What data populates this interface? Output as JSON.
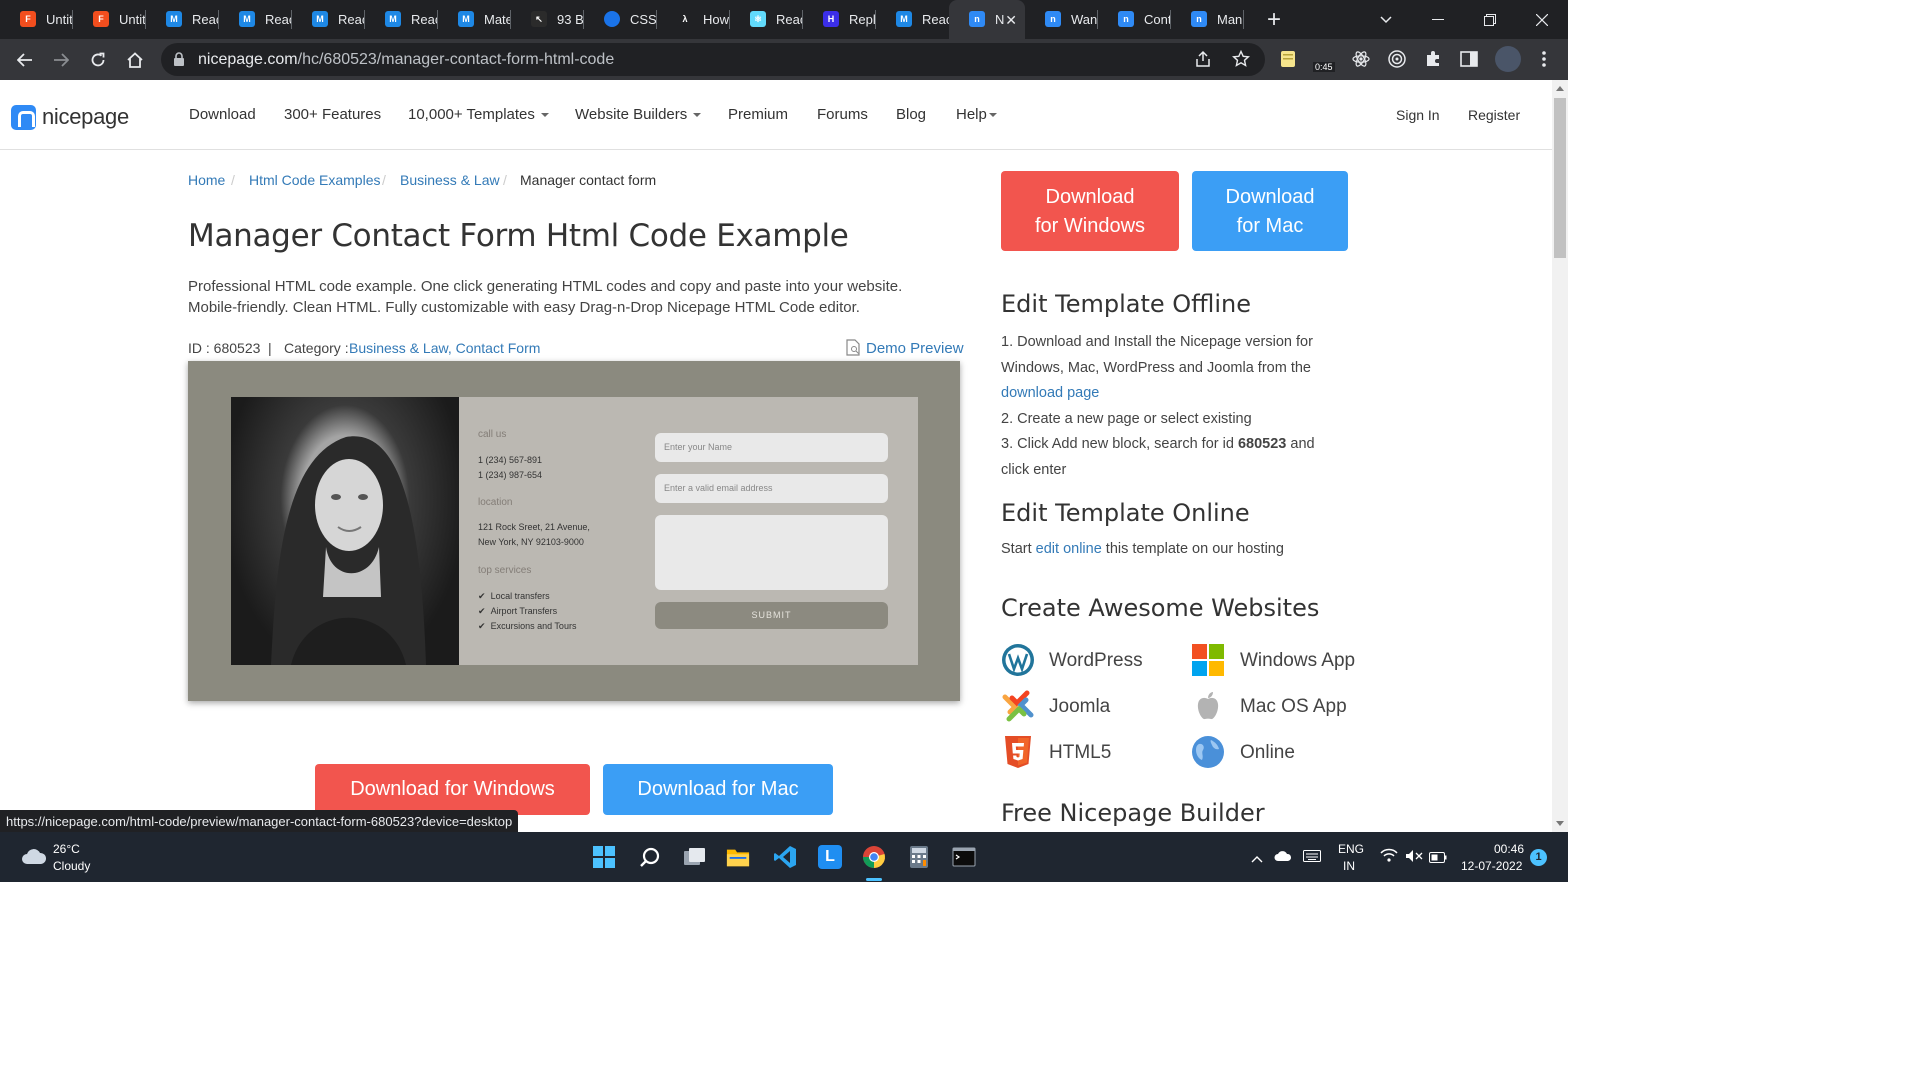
{
  "browser": {
    "tabs": [
      {
        "label": "Untit",
        "icon": "figma-icon",
        "color": "#f24e1e"
      },
      {
        "label": "Untit",
        "icon": "figma-icon",
        "color": "#f24e1e"
      },
      {
        "label": "Reac",
        "icon": "mui-icon",
        "color": "#1e88e5"
      },
      {
        "label": "Reac",
        "icon": "mui-icon",
        "color": "#1e88e5"
      },
      {
        "label": "Reac",
        "icon": "mui-icon",
        "color": "#1e88e5"
      },
      {
        "label": "Reac",
        "icon": "mui-icon",
        "color": "#1e88e5"
      },
      {
        "label": "Mate",
        "icon": "mui-icon",
        "color": "#1e88e5"
      },
      {
        "label": "93 B",
        "icon": "cursor-icon",
        "color": "#2b2b2b"
      },
      {
        "label": "CSS",
        "icon": "globe-icon",
        "color": "#1a73e8"
      },
      {
        "label": "How",
        "icon": "lambda-icon",
        "color": "#202124"
      },
      {
        "label": "Reac",
        "icon": "react-icon",
        "color": "#61dafb"
      },
      {
        "label": "Repl",
        "icon": "hashnode-icon",
        "color": "#3b2ee8"
      },
      {
        "label": "Reac",
        "icon": "mui-icon",
        "color": "#1e88e5"
      },
      {
        "label": "N",
        "icon": "nicepage-icon",
        "color": "#2f8af5"
      },
      {
        "label": "Wan",
        "icon": "nicepage-icon",
        "color": "#2f8af5"
      },
      {
        "label": "Cont",
        "icon": "nicepage-icon",
        "color": "#2f8af5"
      },
      {
        "label": "Man",
        "icon": "nicepage-icon",
        "color": "#2f8af5"
      }
    ],
    "close_glyph": "✕",
    "new_tab_glyph": "+",
    "url_host": "nicepage.com",
    "url_path": "/hc/680523/manager-contact-form-html-code",
    "ext_badge": "0:45"
  },
  "site": {
    "logo_text": "nicepage",
    "nav": [
      {
        "label": "Download",
        "dropdown": false
      },
      {
        "label": "300+ Features",
        "dropdown": false
      },
      {
        "label": "10,000+ Templates",
        "dropdown": true
      },
      {
        "label": "Website Builders",
        "dropdown": true
      },
      {
        "label": "Premium",
        "dropdown": false
      },
      {
        "label": "Forums",
        "dropdown": false
      },
      {
        "label": "Blog",
        "dropdown": false
      },
      {
        "label": "Help",
        "dropdown": true
      }
    ],
    "sign_in": "Sign In",
    "register": "Register"
  },
  "page": {
    "breadcrumbs": [
      "Home",
      "Html Code Examples",
      "Business & Law",
      "Manager contact form"
    ],
    "breadcrumb_sep": "/",
    "title": "Manager Contact Form Html Code Example",
    "description": "Professional HTML code example. One click generating HTML codes and copy and paste into your website. Mobile-friendly. Clean HTML. Fully customizable with easy Drag-n-Drop Nicepage HTML Code editor.",
    "id_label": "ID : 680523",
    "meta_sep": "|",
    "category_label": "Category :",
    "categories": "Business & Law, Contact Form",
    "demo_preview": "Demo Preview",
    "download_windows": "Download for Windows",
    "download_mac": "Download for Mac"
  },
  "preview": {
    "call_us": "call us",
    "phone1": "1 (234) 567-891",
    "phone2": "1 (234) 987-654",
    "location": "location",
    "address1": "121 Rock Sreet, 21 Avenue,",
    "address2": "New York, NY 92103-9000",
    "top_services": "top services",
    "services": [
      "Local transfers",
      "Airport Transfers",
      "Excursions and Tours"
    ],
    "check": "✔",
    "name_placeholder": "Enter your Name",
    "email_placeholder": "Enter a valid email address",
    "submit": "SUBMIT"
  },
  "sidebar": {
    "download_windows_line1": "Download",
    "download_windows_line2": "for Windows",
    "download_mac_line1": "Download",
    "download_mac_line2": "for Mac",
    "offline_title": "Edit Template Offline",
    "step1": "1. Download and Install the Nicepage version for Windows, Mac, WordPress and Joomla from the",
    "step1_link": "download page",
    "step2": "2. Create a new page or select existing",
    "step3_pre": "3. Click Add new block, search for id",
    "step3_id": "680523",
    "step3_post": "and click enter",
    "online_title": "Edit Template Online",
    "online_pre": "Start",
    "online_link": "edit online",
    "online_post": "this template on our hosting",
    "create_title": "Create Awesome Websites",
    "apps": [
      {
        "label": "WordPress",
        "icon": "wordpress-icon"
      },
      {
        "label": "Windows App",
        "icon": "windows-icon"
      },
      {
        "label": "Joomla",
        "icon": "joomla-icon"
      },
      {
        "label": "Mac OS App",
        "icon": "apple-icon"
      },
      {
        "label": "HTML5",
        "icon": "html5-icon"
      },
      {
        "label": "Online",
        "icon": "globe-icon"
      }
    ],
    "free_title": "Free Nicepage Builder"
  },
  "status_url": "https://nicepage.com/html-code/preview/manager-contact-form-680523?device=desktop",
  "taskbar": {
    "temp": "26°C",
    "weather": "Cloudy",
    "lang1": "ENG",
    "lang2": "IN",
    "time": "00:46",
    "date": "12-07-2022",
    "notif_count": "1"
  },
  "colors": {
    "link": "#337ab7",
    "red_button": "#f2554e",
    "blue_button": "#3b9ef5",
    "brand": "#2f8af5"
  }
}
